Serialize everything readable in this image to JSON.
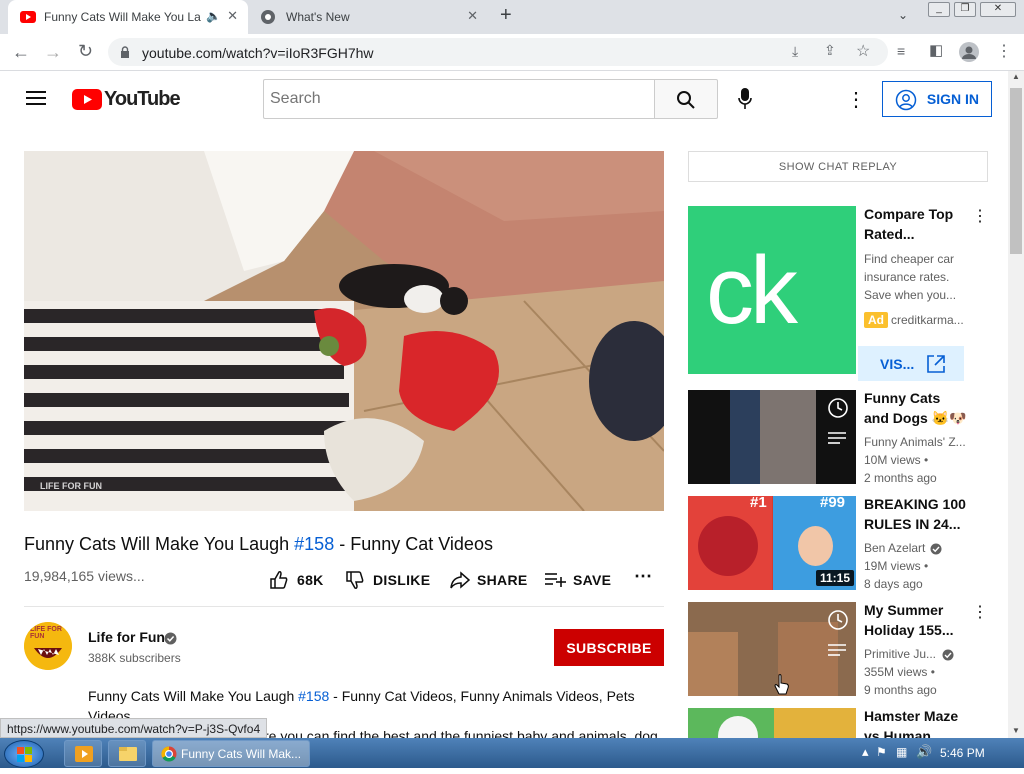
{
  "browser": {
    "tabs": [
      {
        "title": "Funny Cats Will Make You La",
        "close": "✕"
      },
      {
        "title": "What's New",
        "close": "✕"
      }
    ],
    "new_tab": "+",
    "url": "youtube.com/watch?v=iIoR3FGH7hw",
    "status_url": "https://www.youtube.com/watch?v=P-j3S-Qvfo4"
  },
  "youtube": {
    "logo_text": "YouTube",
    "search_placeholder": "Search",
    "sign_in": "SIGN IN"
  },
  "video": {
    "title_prefix": "Funny Cats Will Make You Laugh ",
    "title_tag": "#158",
    "title_suffix": " - Funny Cat Videos",
    "views": "19,984,165 views...",
    "likes": "68K",
    "dislike": "DISLIKE",
    "share": "SHARE",
    "save": "SAVE",
    "watermark": "LIFE FOR FUN"
  },
  "channel": {
    "name": "Life for Fun",
    "subscribers": "388K subscribers",
    "subscribe": "SUBSCRIBE",
    "avatar_text": "LIFE FOR FUN"
  },
  "description": {
    "line1_prefix": "Funny Cats Will Make You Laugh ",
    "line1_tag": "#158",
    "line1_suffix": " - Funny Cat Videos, Funny Animals Videos, Pets",
    "line2": "Videos",
    "line3": "re you can find the best and the funniest baby and animals, dog,"
  },
  "sidebar": {
    "chat_replay": "SHOW CHAT REPLAY",
    "ad": {
      "title": "Compare Top Rated...",
      "desc": "Find cheaper car insurance rates. Save when you...",
      "badge": "Ad",
      "advertiser": "creditkarma...",
      "visit": "VIS...",
      "logo_text": "ck",
      "logo_color": "#2fcf7a"
    },
    "videos": [
      {
        "title": "Funny Cats and Dogs 🐱🐶 |...",
        "channel": "Funny Animals' Z...",
        "views": "10M views •",
        "age": "2 months ago"
      },
      {
        "title": "BREAKING 100 RULES IN 24...",
        "channel": "Ben Azelart",
        "views": "19M views •",
        "age": "8 days ago",
        "duration": "11:15",
        "thumb_labels": [
          "#1",
          "#99"
        ]
      },
      {
        "title": "My Summer Holiday 155...",
        "channel": "Primitive Ju...",
        "views": "355M views •",
        "age": "9 months ago"
      },
      {
        "title": "Hamster Maze vs Human..."
      }
    ]
  },
  "taskbar": {
    "active_window": "Funny Cats Will Mak...",
    "clock": "5:46 PM"
  },
  "colors": {
    "yt_red": "#ff0000",
    "subscribe_red": "#cc0000",
    "link_blue": "#065fd4"
  }
}
